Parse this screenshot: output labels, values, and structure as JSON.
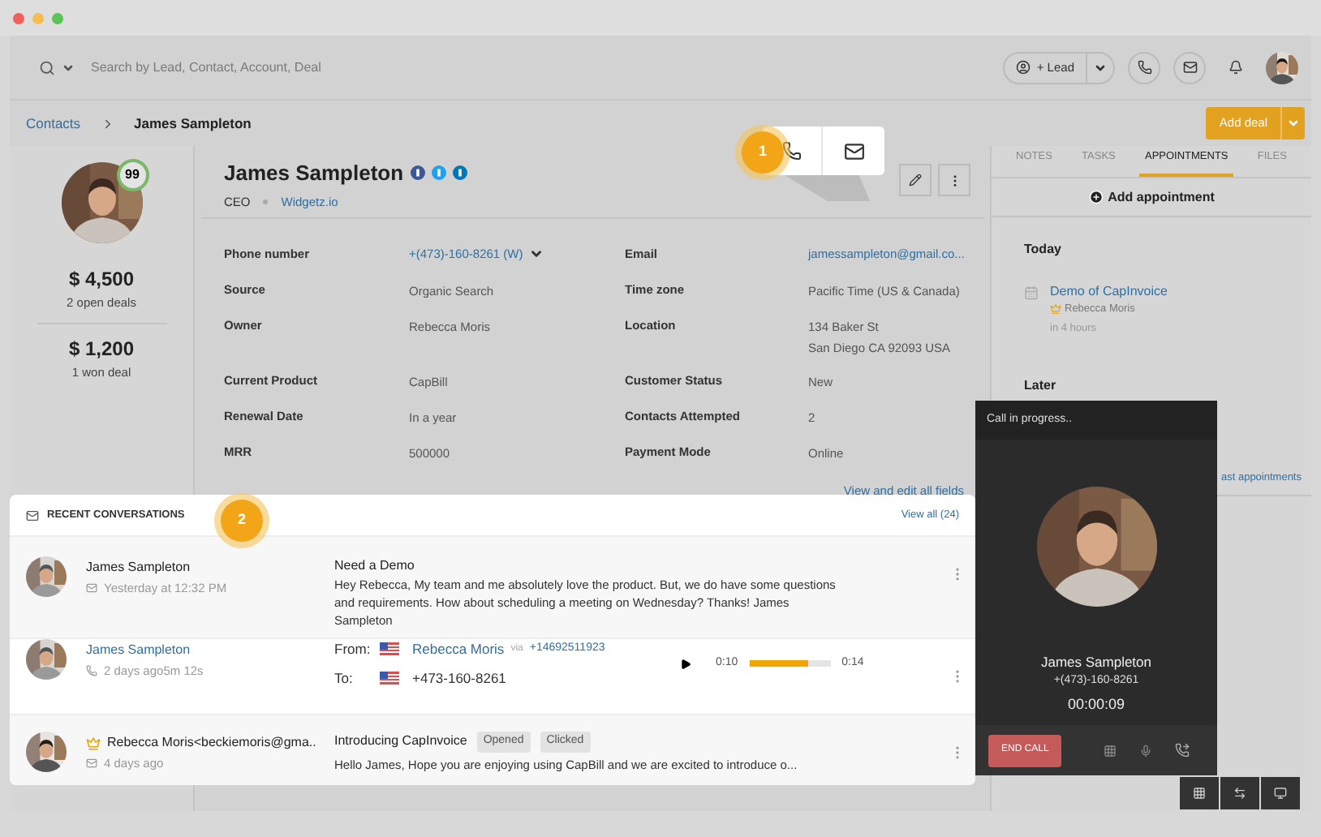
{
  "topbar": {
    "search_placeholder": "Search by Lead, Contact, Account, Deal",
    "lead_button": "+ Lead"
  },
  "breadcrumb": {
    "items": [
      "Contacts",
      "James Sampleton"
    ],
    "add_deal": "Add deal"
  },
  "summary": {
    "score": "99",
    "stats": [
      {
        "amount": "$ 4,500",
        "label": "2 open deals"
      },
      {
        "amount": "$ 1,200",
        "label": "1 won deal"
      }
    ]
  },
  "contact": {
    "name": "James Sampleton",
    "title": "CEO",
    "company": "Widgetz.io",
    "fields": [
      {
        "label": "Phone number",
        "value": "+(473)-160-8261 (W)",
        "kind": "phone"
      },
      {
        "label": "Email",
        "value": "jamessampleton@gmail.co...",
        "kind": "link"
      },
      {
        "label": "Source",
        "value": "Organic Search",
        "kind": "text"
      },
      {
        "label": "Time zone",
        "value": "Pacific Time (US & Canada)",
        "kind": "text"
      },
      {
        "label": "Owner",
        "value": "Rebecca Moris",
        "kind": "text"
      },
      {
        "label": "Location",
        "value": "134 Baker St\nSan Diego CA 92093 USA",
        "kind": "text"
      },
      {
        "label": "Current Product",
        "value": "CapBill",
        "kind": "text"
      },
      {
        "label": "Customer Status",
        "value": "New",
        "kind": "text"
      },
      {
        "label": "Renewal Date",
        "value": "In a year",
        "kind": "text"
      },
      {
        "label": "Contacts Attempted",
        "value": "2",
        "kind": "text"
      },
      {
        "label": "MRR",
        "value": "500000",
        "kind": "text"
      },
      {
        "label": "Payment Mode",
        "value": "Online",
        "kind": "text"
      }
    ],
    "view_all": "View and edit all fields"
  },
  "tour_steps": [
    "1",
    "2"
  ],
  "tabs": [
    {
      "label": "NOTES",
      "selected": false
    },
    {
      "label": "TASKS",
      "selected": false
    },
    {
      "label": "APPOINTMENTS",
      "selected": true
    },
    {
      "label": "FILES",
      "selected": false
    }
  ],
  "appointments": {
    "add": "Add appointment",
    "today": "Today",
    "items": [
      {
        "title": "Demo of CapInvoice",
        "owner": "Rebecca Moris",
        "time": "in 4 hours"
      }
    ],
    "later": "Later",
    "past_link": "ast appointments"
  },
  "conversations": {
    "title": "RECENT CONVERSATIONS",
    "view_all": "View all (24)",
    "items": [
      {
        "kind": "email",
        "name": "James Sampleton",
        "meta": "Yesterday at 12:32 PM",
        "subject": "Need a Demo",
        "body": "Hey Rebecca, My team and me absolutely love the product. But, we do have some questions and requirements. How about scheduling a meeting on Wednesday? Thanks! James Sampleton"
      },
      {
        "kind": "call",
        "name": "James Sampleton",
        "meta": "2 days ago5m 12s",
        "from_label": "From:",
        "from_name": "Rebecca Moris",
        "via": "via",
        "via_number": "+14692511923",
        "to_label": "To:",
        "to_number": "+473-160-8261",
        "elapsed": "0:10",
        "duration": "0:14",
        "level": 0.72
      },
      {
        "kind": "campaign",
        "name": "Rebecca Moris<beckiemoris@gma..",
        "meta": "4 days ago",
        "subject": "Introducing CapInvoice",
        "tags": [
          "Opened",
          "Clicked"
        ],
        "body": "Hello James, Hope you are enjoying using CapBill and we are excited to introduce o..."
      }
    ]
  },
  "call": {
    "status": "Call in progress..",
    "name": "James Sampleton",
    "phone": "+(473)-160-8261",
    "timer": "00:00:09",
    "end": "END CALL"
  }
}
